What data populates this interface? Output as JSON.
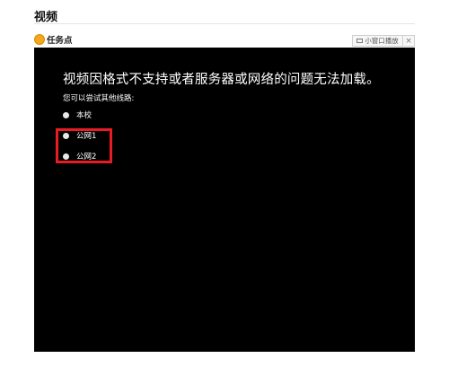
{
  "section": {
    "title": "视频"
  },
  "task": {
    "label": "任务点",
    "icon": "task-point-icon",
    "icon_color": "#f3a81c"
  },
  "mini_player": {
    "label": "小窗口播放",
    "icon": "tv-icon",
    "close_icon": "close-icon",
    "close_glyph": "×"
  },
  "player": {
    "background": "#000000",
    "error_message": "视频因格式不支持或者服务器或网络的问题无法加载。",
    "hint": "您可以尝试其他线路:",
    "routes": [
      {
        "label": "本校"
      },
      {
        "label": "公网1"
      },
      {
        "label": "公网2"
      }
    ],
    "highlight_color": "#e81c24"
  }
}
